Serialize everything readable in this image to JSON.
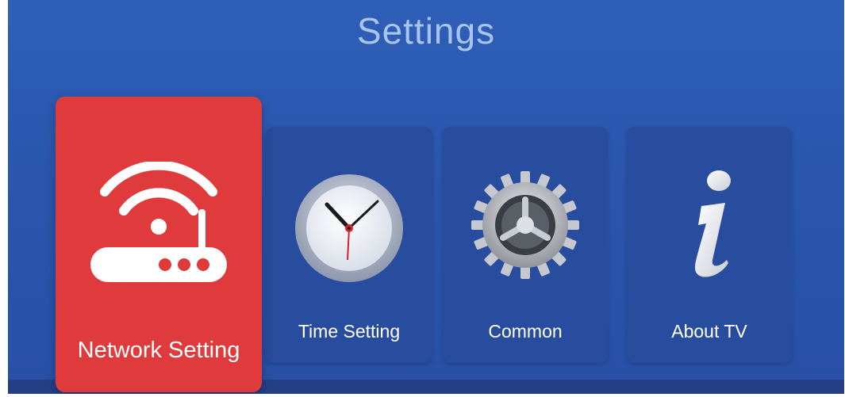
{
  "header": {
    "title": "Settings"
  },
  "menu": {
    "items": [
      {
        "label": "Network Setting",
        "icon": "router-wifi-icon",
        "selected": true
      },
      {
        "label": "Time Setting",
        "icon": "clock-icon",
        "selected": false
      },
      {
        "label": "Common",
        "icon": "gear-icon",
        "selected": false
      },
      {
        "label": "About TV",
        "icon": "info-icon",
        "selected": false
      }
    ]
  },
  "colors": {
    "background": "#2a56ad",
    "selected_tile": "#df3b3d",
    "tile": "#284c9e",
    "title_text": "#a9c4ee"
  }
}
